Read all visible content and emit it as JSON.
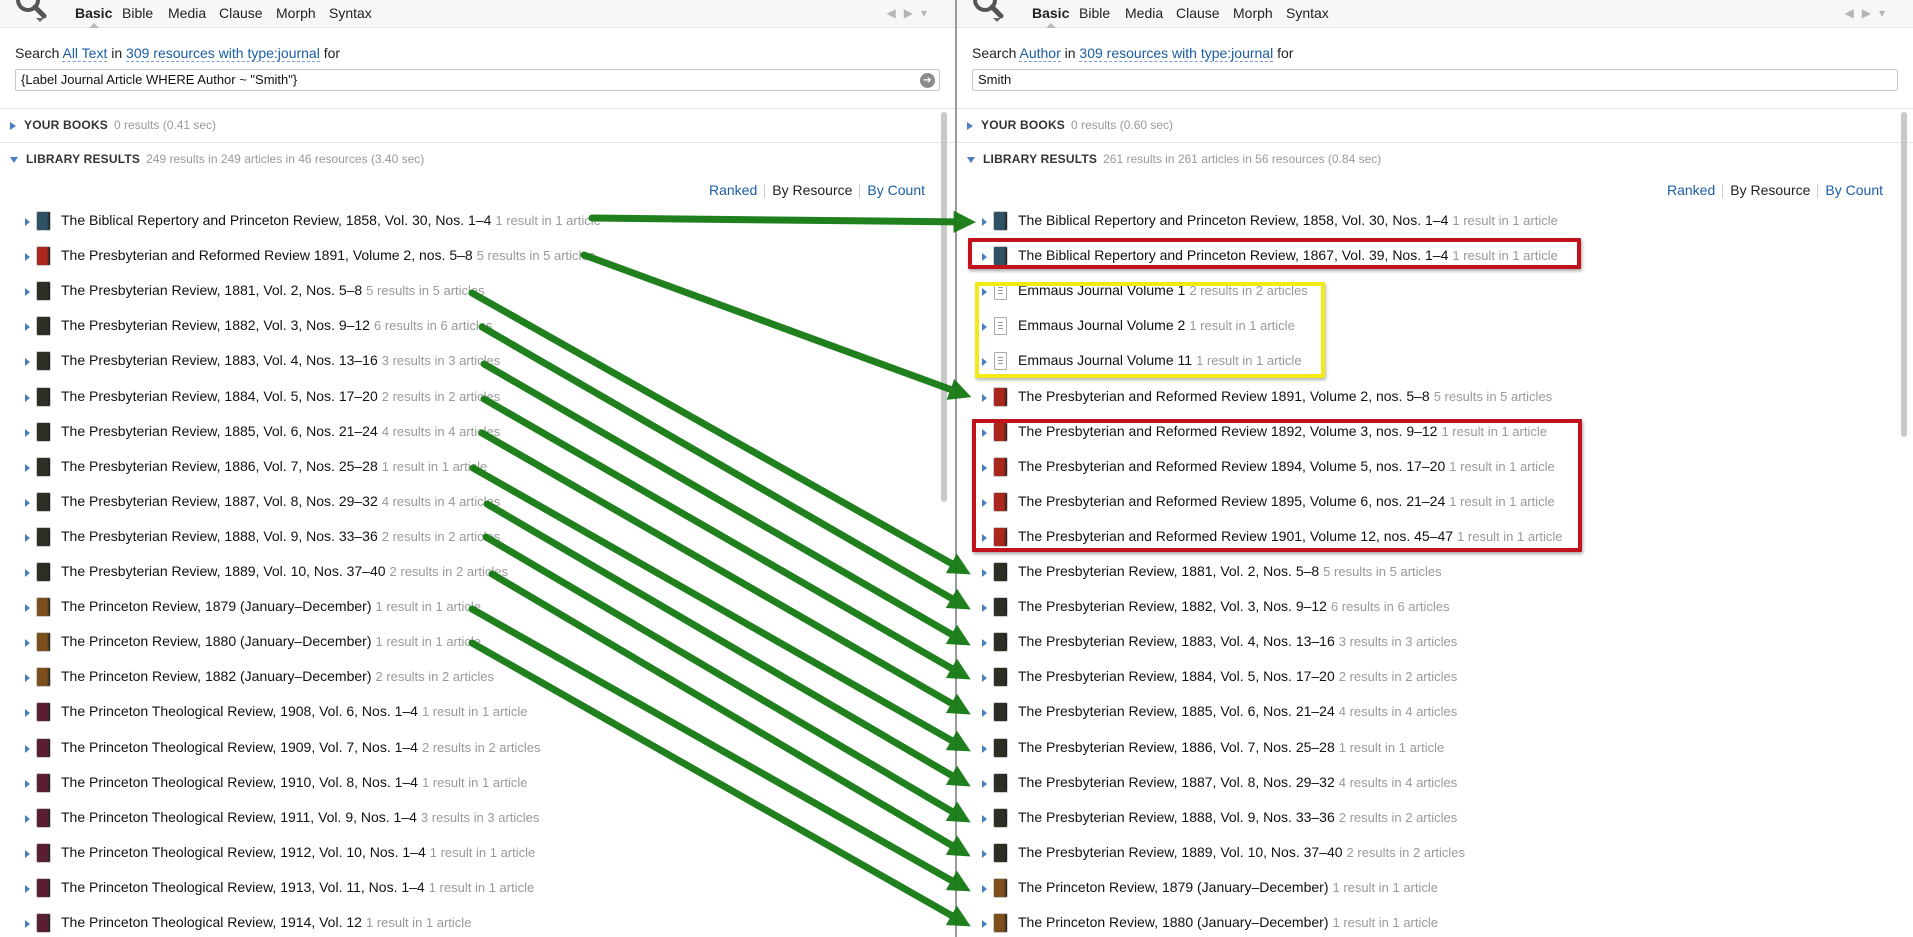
{
  "left": {
    "tabs": [
      "Basic",
      "Bible",
      "Media",
      "Clause",
      "Morph",
      "Syntax"
    ],
    "search_line": {
      "prefix": "Search",
      "field": "All Text",
      "in_word": "in",
      "resources": "309 resources with type:journal",
      "for_word": "for"
    },
    "query": "{Label Journal Article WHERE Author ~ \"Smith\"}",
    "your_books": {
      "title": "YOUR BOOKS",
      "meta": "0 results (0.41 sec)"
    },
    "library": {
      "title": "LIBRARY RESULTS",
      "meta": "249 results in 249 articles in 46 resources (3.40 sec)"
    },
    "sort": [
      "Ranked",
      "By Resource",
      "By Count"
    ],
    "rows": [
      {
        "title": "The Biblical Repertory and Princeton Review, 1858, Vol. 30, Nos. 1–4",
        "meta": "1 result in 1 article"
      },
      {
        "title": "The Presbyterian and Reformed Review 1891, Volume 2, nos. 5–8",
        "meta": "5 results in 5 articles"
      },
      {
        "title": "The Presbyterian Review, 1881, Vol. 2, Nos. 5–8",
        "meta": "5 results in 5 articles"
      },
      {
        "title": "The Presbyterian Review, 1882, Vol. 3, Nos. 9–12",
        "meta": "6 results in 6 articles"
      },
      {
        "title": "The Presbyterian Review, 1883, Vol. 4, Nos. 13–16",
        "meta": "3 results in 3 articles"
      },
      {
        "title": "The Presbyterian Review, 1884, Vol. 5, Nos. 17–20",
        "meta": "2 results in 2 articles"
      },
      {
        "title": "The Presbyterian Review, 1885, Vol. 6, Nos. 21–24",
        "meta": "4 results in 4 articles"
      },
      {
        "title": "The Presbyterian Review, 1886, Vol. 7, Nos. 25–28",
        "meta": "1 result in 1 article"
      },
      {
        "title": "The Presbyterian Review, 1887, Vol. 8, Nos. 29–32",
        "meta": "4 results in 4 articles"
      },
      {
        "title": "The Presbyterian Review, 1888, Vol. 9, Nos. 33–36",
        "meta": "2 results in 2 articles"
      },
      {
        "title": "The Presbyterian Review, 1889, Vol. 10, Nos. 37–40",
        "meta": "2 results in 2 articles"
      },
      {
        "title": "The Princeton Review, 1879 (January–December)",
        "meta": "1 result in 1 article"
      },
      {
        "title": "The Princeton Review, 1880 (January–December)",
        "meta": "1 result in 1 article"
      },
      {
        "title": "The Princeton Review, 1882 (January–December)",
        "meta": "2 results in 2 articles"
      },
      {
        "title": "The Princeton Theological Review, 1908, Vol. 6, Nos. 1–4",
        "meta": "1 result in 1 article"
      },
      {
        "title": "The Princeton Theological Review, 1909, Vol. 7, Nos. 1–4",
        "meta": "2 results in 2 articles"
      },
      {
        "title": "The Princeton Theological Review, 1910, Vol. 8, Nos. 1–4",
        "meta": "1 result in 1 article"
      },
      {
        "title": "The Princeton Theological Review, 1911, Vol. 9, Nos. 1–4",
        "meta": "3 results in 3 articles"
      },
      {
        "title": "The Princeton Theological Review, 1912, Vol. 10, Nos. 1–4",
        "meta": "1 result in 1 article"
      },
      {
        "title": "The Princeton Theological Review, 1913, Vol. 11, Nos. 1–4",
        "meta": "1 result in 1 article"
      },
      {
        "title": "The Princeton Theological Review, 1914, Vol. 12",
        "meta": "1 result in 1 article"
      }
    ]
  },
  "right": {
    "tabs": [
      "Basic",
      "Bible",
      "Media",
      "Clause",
      "Morph",
      "Syntax"
    ],
    "search_line": {
      "prefix": "Search",
      "field": "Author",
      "in_word": "in",
      "resources": "309 resources with type:journal",
      "for_word": "for"
    },
    "query": "Smith",
    "your_books": {
      "title": "YOUR BOOKS",
      "meta": "0 results (0.60 sec)"
    },
    "library": {
      "title": "LIBRARY RESULTS",
      "meta": "261 results in 261 articles in 56 resources (0.84 sec)"
    },
    "sort": [
      "Ranked",
      "By Resource",
      "By Count"
    ],
    "rows": [
      {
        "title": "The Biblical Repertory and Princeton Review, 1858, Vol. 30, Nos. 1–4",
        "meta": "1 result in 1 article"
      },
      {
        "title": "The Biblical Repertory and Princeton Review, 1867, Vol. 39, Nos. 1–4",
        "meta": "1 result in 1 article"
      },
      {
        "title": "Emmaus Journal Volume 1",
        "meta": "2 results in 2 articles"
      },
      {
        "title": "Emmaus Journal Volume 2",
        "meta": "1 result in 1 article"
      },
      {
        "title": "Emmaus Journal Volume 11",
        "meta": "1 result in 1 article"
      },
      {
        "title": "The Presbyterian and Reformed Review 1891, Volume 2, nos. 5–8",
        "meta": "5 results in 5 articles"
      },
      {
        "title": "The Presbyterian and Reformed Review 1892, Volume 3, nos. 9–12",
        "meta": "1 result in 1 article"
      },
      {
        "title": "The Presbyterian and Reformed Review 1894, Volume 5, nos. 17–20",
        "meta": "1 result in 1 article"
      },
      {
        "title": "The Presbyterian and Reformed Review 1895, Volume 6, nos. 21–24",
        "meta": "1 result in 1 article"
      },
      {
        "title": "The Presbyterian and Reformed Review 1901, Volume 12, nos. 45–47",
        "meta": "1 result in 1 article"
      },
      {
        "title": "The Presbyterian Review, 1881, Vol. 2, Nos. 5–8",
        "meta": "5 results in 5 articles"
      },
      {
        "title": "The Presbyterian Review, 1882, Vol. 3, Nos. 9–12",
        "meta": "6 results in 6 articles"
      },
      {
        "title": "The Presbyterian Review, 1883, Vol. 4, Nos. 13–16",
        "meta": "3 results in 3 articles"
      },
      {
        "title": "The Presbyterian Review, 1884, Vol. 5, Nos. 17–20",
        "meta": "2 results in 2 articles"
      },
      {
        "title": "The Presbyterian Review, 1885, Vol. 6, Nos. 21–24",
        "meta": "4 results in 4 articles"
      },
      {
        "title": "The Presbyterian Review, 1886, Vol. 7, Nos. 25–28",
        "meta": "1 result in 1 article"
      },
      {
        "title": "The Presbyterian Review, 1887, Vol. 8, Nos. 29–32",
        "meta": "4 results in 4 articles"
      },
      {
        "title": "The Presbyterian Review, 1888, Vol. 9, Nos. 33–36",
        "meta": "2 results in 2 articles"
      },
      {
        "title": "The Presbyterian Review, 1889, Vol. 10, Nos. 37–40",
        "meta": "2 results in 2 articles"
      },
      {
        "title": "The Princeton Review, 1879 (January–December)",
        "meta": "1 result in 1 article"
      },
      {
        "title": "The Princeton Review, 1880 (January–December)",
        "meta": "1 result in 1 article"
      }
    ]
  },
  "colors": {
    "link": "#1a5da6",
    "arrow": "#157a12",
    "highlight_red": "#c2121b",
    "highlight_yellow": "#f2ea16",
    "cover_blue": "#2f5364",
    "cover_red": "#a9271d",
    "cover_dark": "#2e2e24",
    "cover_gold": "#7d4f1d",
    "cover_maroon": "#5a1f33"
  },
  "icons": {
    "search": "magnifier-icon",
    "back": "back-arrow-icon",
    "forward": "forward-arrow-icon",
    "menu": "dropdown-icon",
    "go": "go-arrow-icon"
  }
}
